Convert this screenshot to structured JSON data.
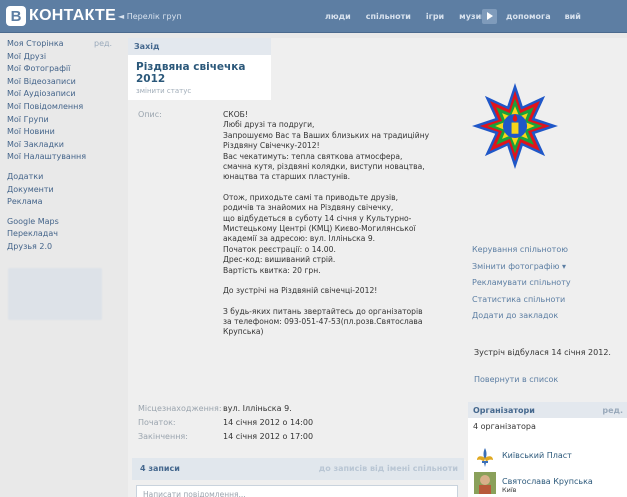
{
  "header": {
    "logo_letter": "B",
    "logo_text": "КОНТАКТЕ",
    "back_link": "◄ Перелік груп",
    "nav": [
      "люди",
      "спільноти",
      "ігри",
      "музика"
    ],
    "nav2": [
      "допомога",
      "вий"
    ]
  },
  "sidebar": {
    "edit_label": "ред.",
    "items": [
      "Моя Сторінка",
      "Мої Друзі",
      "Мої Фотографії",
      "Мої Відеозаписи",
      "Мої Аудіозаписи",
      "Мої Повідомлення",
      "Мої Групи",
      "Мої Новини",
      "Мої Закладки",
      "Мої Налаштування"
    ],
    "items2": [
      "Додатки",
      "Документи",
      "Реклама"
    ],
    "items3": [
      "Google Maps",
      "Перекладач",
      "Друзья 2.0"
    ]
  },
  "event": {
    "section_label": "Захід",
    "title": "Різдвяна свічечка 2012",
    "change_status": "змінити статус",
    "desc_label": "Опис:",
    "description": [
      "СКОБ!\nЛюбі друзі та подруги,\nЗапрошуємо Вас та Ваших близьких на традиційну\nРіздвяну Свічечку-2012!\nВас чекатимуть: тепла святкова атмосфера,\nсмачна кутя, різдвяні колядки, виступи новацтва,\nюнацтва та старших пластунів.",
      "Отож, приходьте самі та приводьте друзів,\nродичів та знайомих на Різдвяну свічечку,\nщо відбудеться в суботу 14 січня у Культурно-\nМистецькому Центрі (КМЦ) Києво-Могилянської\nакадемії за адресою: вул. Ілліньска 9.\nПочаток реєстрації: о 14.00.\nДрес-код: вишиваний стрій.\nВартість квитка: 20 грн.",
      "До зустрічі на Різдвяній свічечці-2012!",
      "З будь-яких питань звертайтесь до організаторів\nза телефоном: 093-051-47-53(пл.розв.Святослава\nКрупська)"
    ],
    "location_label": "Місцезнаходження:",
    "location": "вул. Ілліньска 9.",
    "start_label": "Початок:",
    "start": "14 січня 2012 о 14:00",
    "end_label": "Закінчення:",
    "end": "14 січня 2012 о 17:00",
    "posts_count": "4 записи",
    "posts_link": "до записів від імені спільноти",
    "post_placeholder": "Написати повідомлення..."
  },
  "right": {
    "actions": [
      "Керування спільнотою",
      "Змінити фотографію ▾",
      "Рекламувати спільноту",
      "Статистика спільноти",
      "Додати до закладок"
    ],
    "meeting_status": "Зустріч відбулася 14 січня 2012.",
    "back_to_list": "Повернути в список",
    "organizers_label": "Організатори",
    "organizers_edit": "ред.",
    "organizers_count": "4 організатора",
    "organizers": [
      {
        "name": "Київський Пласт",
        "sub": ""
      },
      {
        "name": "Святослава Крупська",
        "sub": "Київ"
      }
    ]
  },
  "colors": {
    "header": "#5d7ea3",
    "link": "#2b587a",
    "star_blue": "#1f57c8",
    "star_red": "#e0141b",
    "star_green": "#1aa13a",
    "star_yellow": "#f7d51a"
  }
}
